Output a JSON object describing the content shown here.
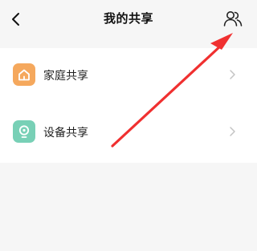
{
  "header": {
    "title": "我的共享",
    "back_icon": "chevron-left-icon",
    "members_icon": "two-people-icon"
  },
  "list": {
    "items": [
      {
        "label": "家庭共享",
        "icon": "home-icon",
        "icon_color": "#f5a85d"
      },
      {
        "label": "设备共享",
        "icon": "device-icon",
        "icon_color": "#78d0b6"
      }
    ]
  },
  "colors": {
    "background": "#f6f6f6",
    "card": "#ffffff",
    "annotation_arrow": "#f03030"
  }
}
